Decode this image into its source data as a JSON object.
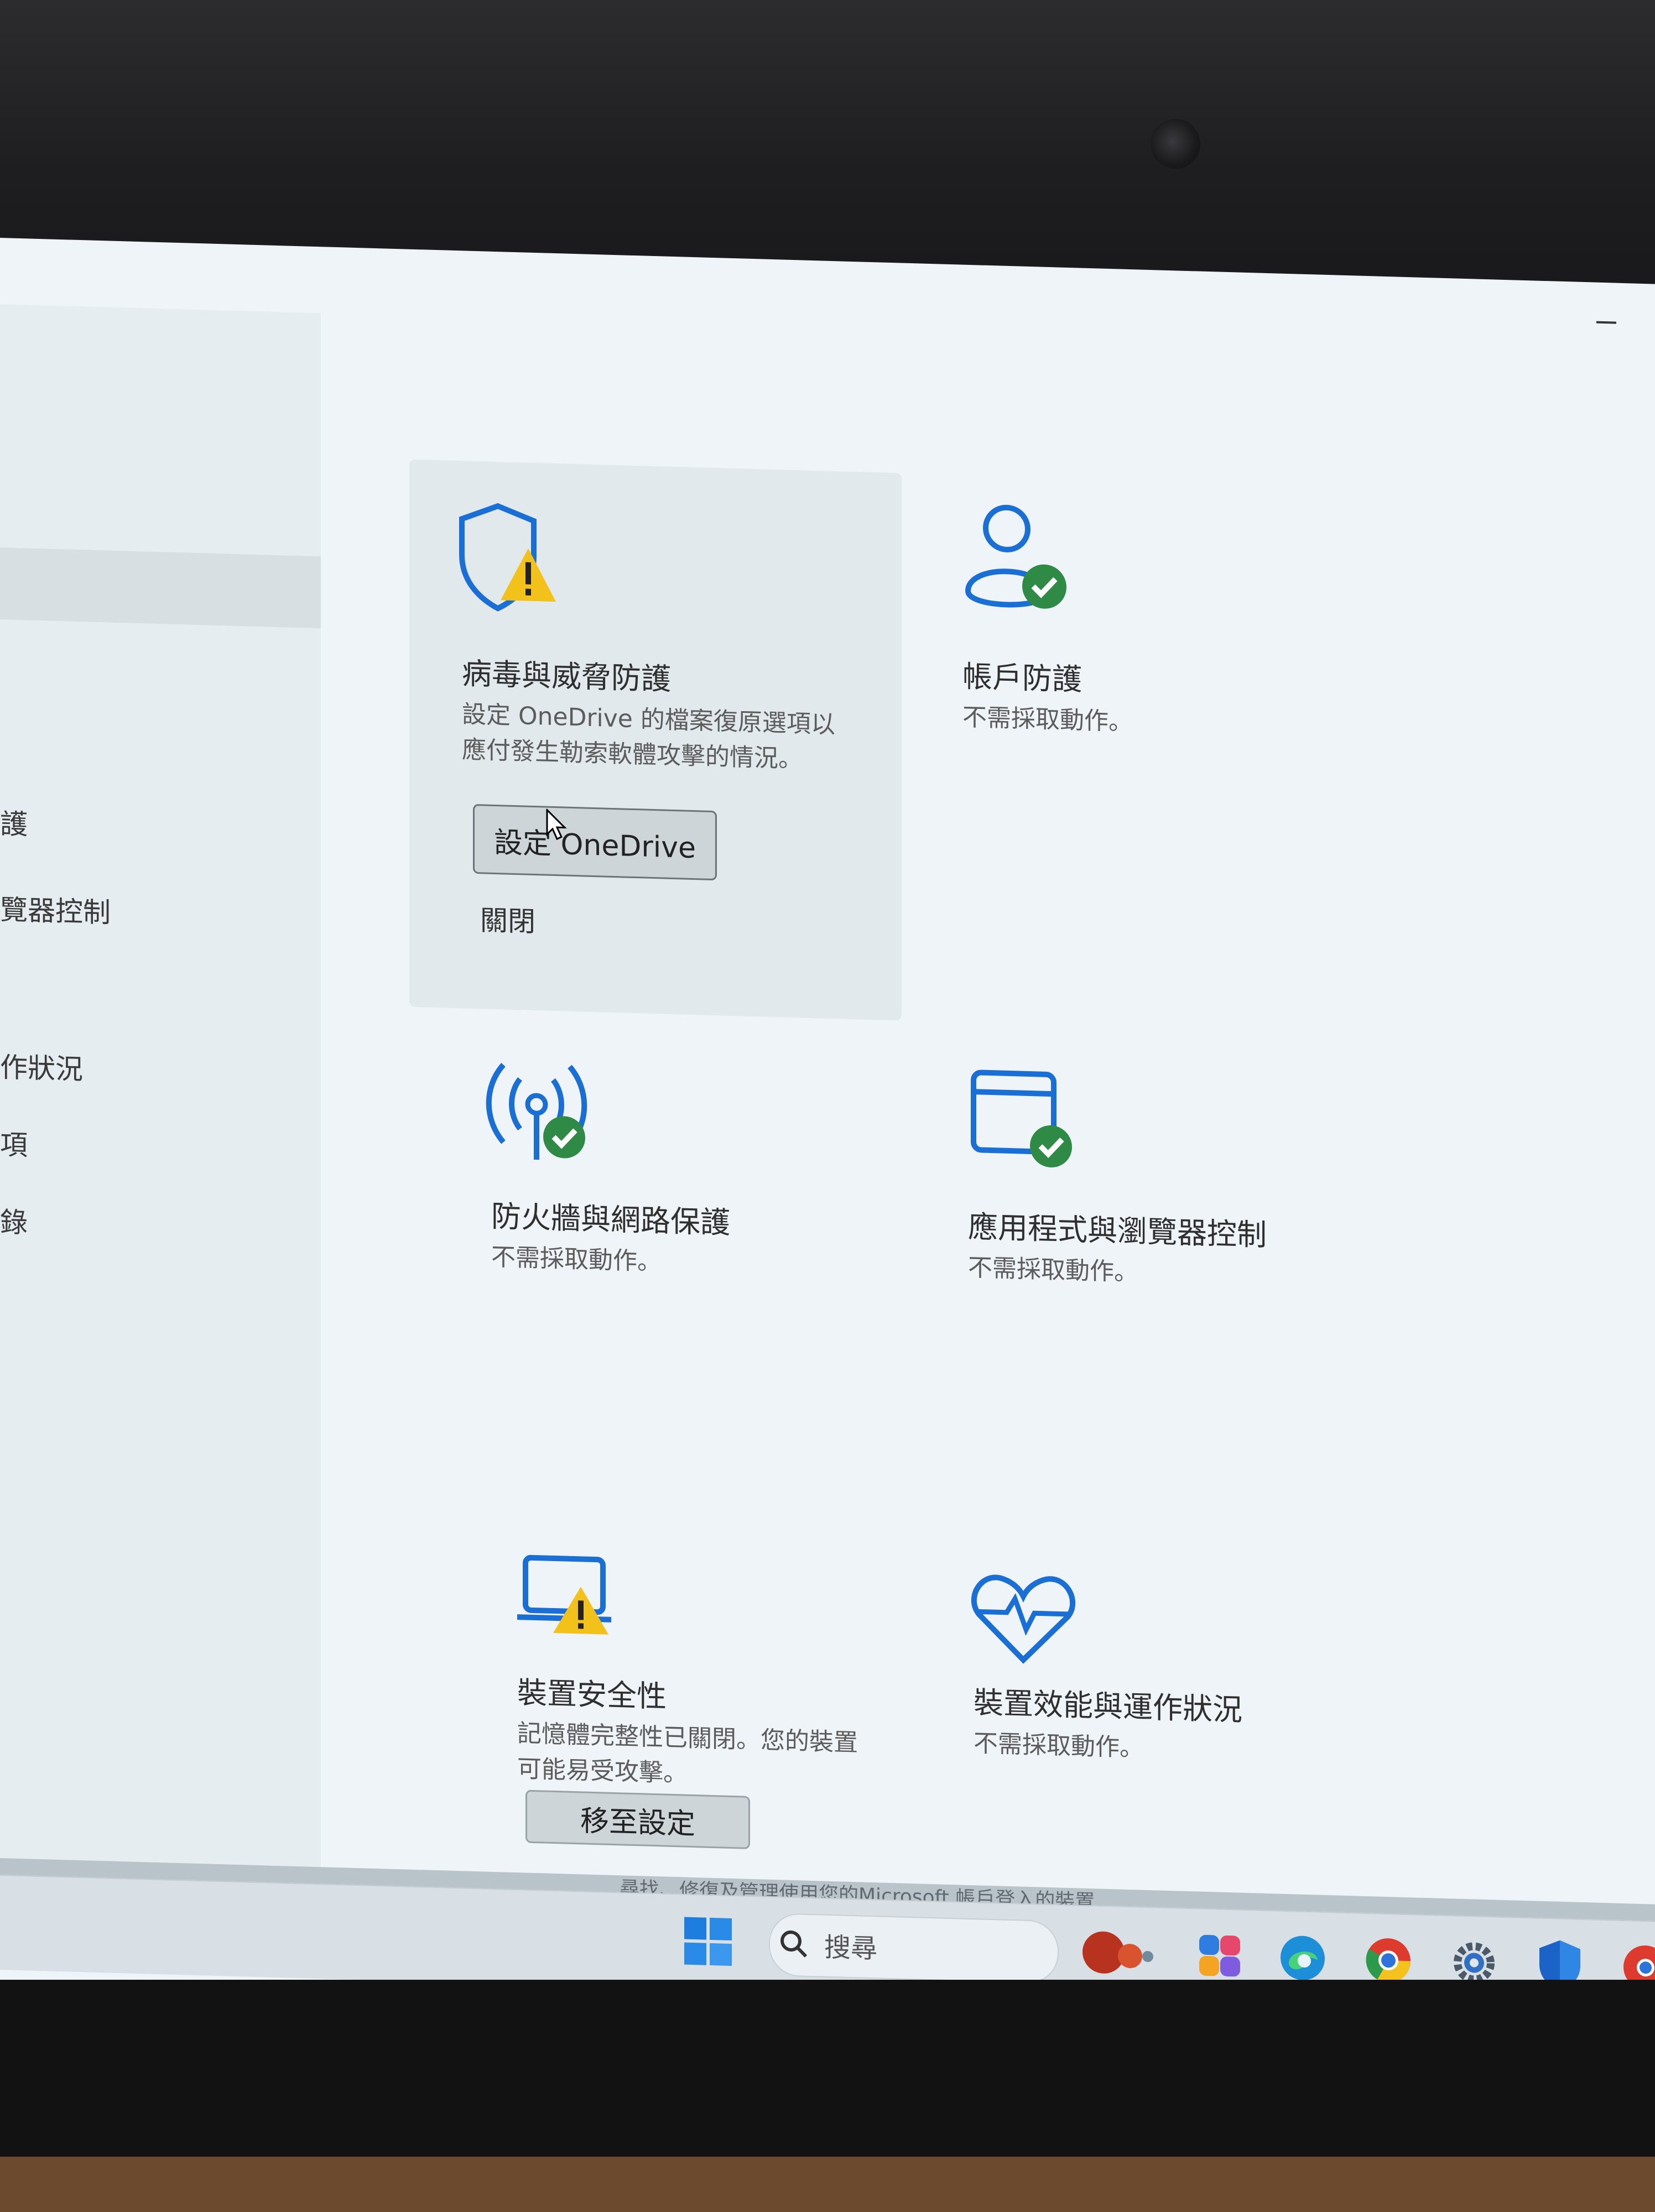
{
  "sidebar": {
    "items": [
      {
        "label": "護"
      },
      {
        "label": "覽器控制"
      },
      {
        "label": "作狀況"
      },
      {
        "label": "項"
      },
      {
        "label": "錄"
      }
    ]
  },
  "tiles": {
    "virus": {
      "title": "病毒與威脅防護",
      "desc_line1": "設定 OneDrive 的檔案復原選項以",
      "desc_line2": "應付發生勒索軟體攻擊的情況。",
      "button_label": "設定 OneDrive",
      "dismiss_label": "關閉"
    },
    "account": {
      "title": "帳戶防護",
      "desc": "不需採取動作。"
    },
    "firewall": {
      "title": "防火牆與網路保護",
      "desc": "不需採取動作。"
    },
    "app_browser": {
      "title": "應用程式與瀏覽器控制",
      "desc": "不需採取動作。"
    },
    "device_security": {
      "title": "裝置安全性",
      "desc_line1": "記憶體完整性已關閉。您的裝置",
      "desc_line2": "可能易受攻擊。",
      "button_label": "移至設定"
    },
    "device_health": {
      "title": "裝置效能與運作狀況",
      "desc": "不需採取動作。"
    }
  },
  "taskbar": {
    "search_placeholder": "搜尋",
    "hint_text": "尋找、修復及管理使用您的Microsoft 帳戶登入的裝置"
  },
  "icons": {
    "start": "windows-start-icon",
    "search": "search-icon",
    "copilot": "copilot-icon",
    "edge": "edge-icon",
    "chrome": "chrome-icon",
    "settings": "gear-icon",
    "security": "windows-security-icon"
  },
  "colors": {
    "accent_blue": "#1a6fd6",
    "warning_yellow": "#f2c21b",
    "ok_green": "#2f8a46"
  }
}
